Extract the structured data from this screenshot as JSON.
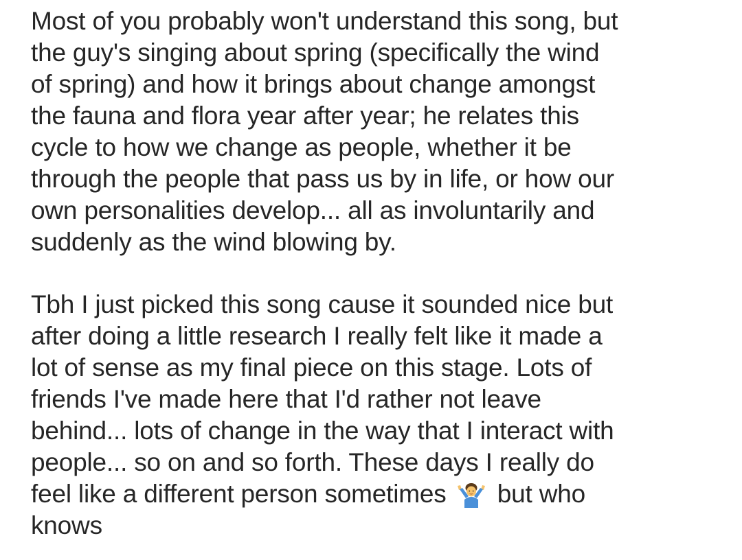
{
  "paragraph1": {
    "lines": [
      "Most of you probably won't understand this song, but",
      "the guy's singing about spring (specifically the wind",
      "of spring) and how it brings about change amongst",
      "the fauna and flora year after year; he relates this",
      "cycle to how we change as people, whether it be",
      "through the people that pass us by in life, or how our",
      "own personalities develop... all as involuntarily and",
      "suddenly as the wind blowing by."
    ]
  },
  "paragraph2": {
    "lines": [
      "Tbh I just picked this song cause it sounded nice but",
      "after doing a little research I really felt like it made a",
      "lot of sense as my final piece on this stage. Lots of",
      "friends I've made here that I'd rather not leave",
      "behind... lots of change in the way that I interact with",
      "people... so on and so forth. These days I really do"
    ],
    "emoji_line_before": "feel like a different person sometimes",
    "emoji_line_after": "but who",
    "last_line": "knows",
    "emoji_icon": "man-shrugging-icon"
  },
  "colors": {
    "text": "#262626",
    "background": "#ffffff"
  }
}
